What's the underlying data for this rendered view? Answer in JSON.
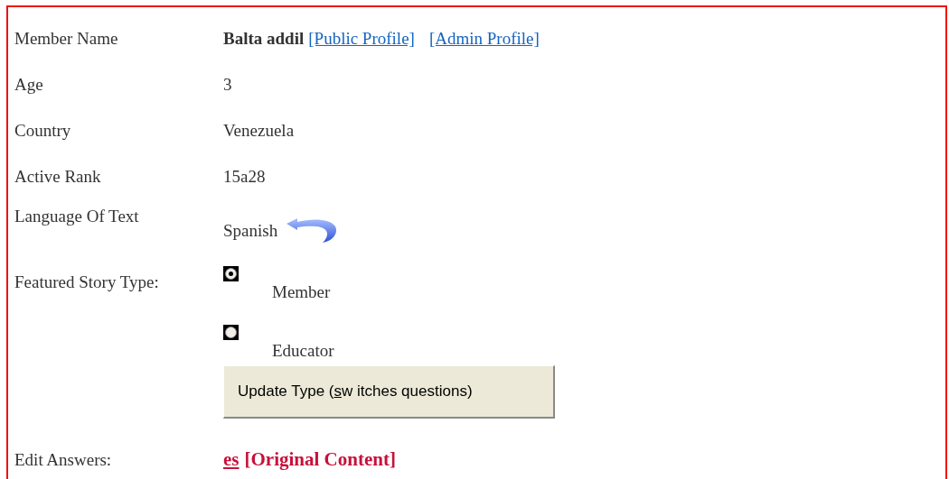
{
  "fields": [
    {
      "kind": "profile",
      "label": "Member Name",
      "name": "Balta addil",
      "links": [
        "[Public Profile]",
        "[Admin Profile]"
      ]
    },
    {
      "kind": "text",
      "label": "Age",
      "value": "3"
    },
    {
      "kind": "text",
      "label": "Country",
      "value": "Venezuela"
    },
    {
      "kind": "text",
      "label": "Active Rank",
      "value": "15a28"
    },
    {
      "kind": "language",
      "label": "Language Of Text",
      "value": "Spanish"
    }
  ],
  "story_type": {
    "label": "Featured Story Type:",
    "options": [
      {
        "label": "Member",
        "selected": true
      },
      {
        "label": "Educator",
        "selected": false
      }
    ],
    "button": {
      "before": "Update Type (",
      "access_key": "s",
      "after": "w itches questions)"
    }
  },
  "edit_answers": {
    "label": "Edit Answers:",
    "link": "es",
    "extra": "[Original Content]"
  }
}
